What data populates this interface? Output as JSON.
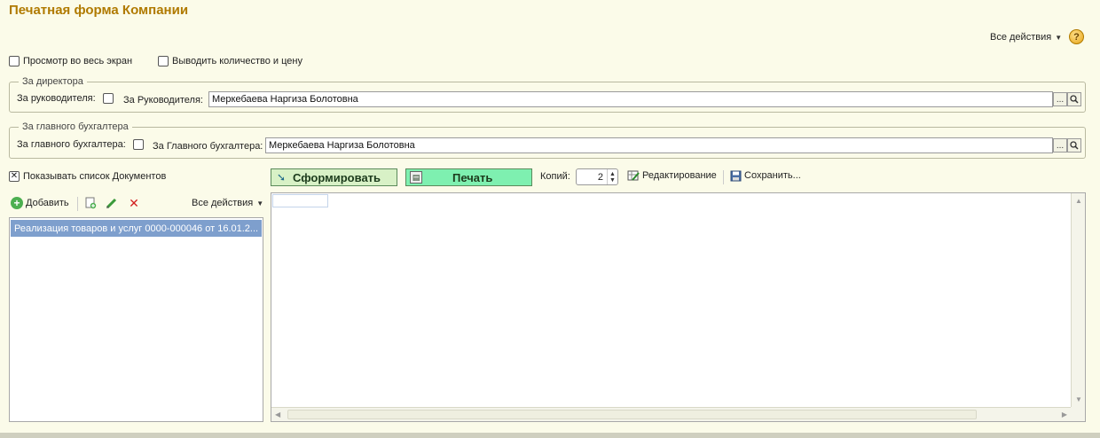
{
  "title": "Печатная форма Компании",
  "header": {
    "all_actions": "Все действия",
    "help": "?"
  },
  "options": {
    "fullscreen_label": "Просмотр во весь экран",
    "qty_price_label": "Выводить количество и цену",
    "show_docs_label": "Показывать список Документов"
  },
  "director": {
    "legend": "За директора",
    "checkbox_label": "За руководителя:",
    "field_label": "За Руководителя:",
    "value": "Меркебаева Наргиза Болотовна"
  },
  "accountant": {
    "legend": "За главного бухгалтера",
    "checkbox_label": "За главного бухгалтера:",
    "field_label": "За Главного бухгалтера:",
    "value": "Меркебаева Наргиза Болотовна"
  },
  "toolbar": {
    "form_label": "Сформировать",
    "print_label": "Печать",
    "copies_label": "Копий:",
    "copies_value": "2",
    "edit_label": "Редактирование",
    "save_label": "Сохранить..."
  },
  "list": {
    "add_label": "Добавить",
    "all_actions": "Все действия",
    "items": [
      "Реализация товаров и услуг 0000-000046 от 16.01.2..."
    ]
  },
  "icons": {
    "lookup": "...",
    "search": "🔍"
  }
}
